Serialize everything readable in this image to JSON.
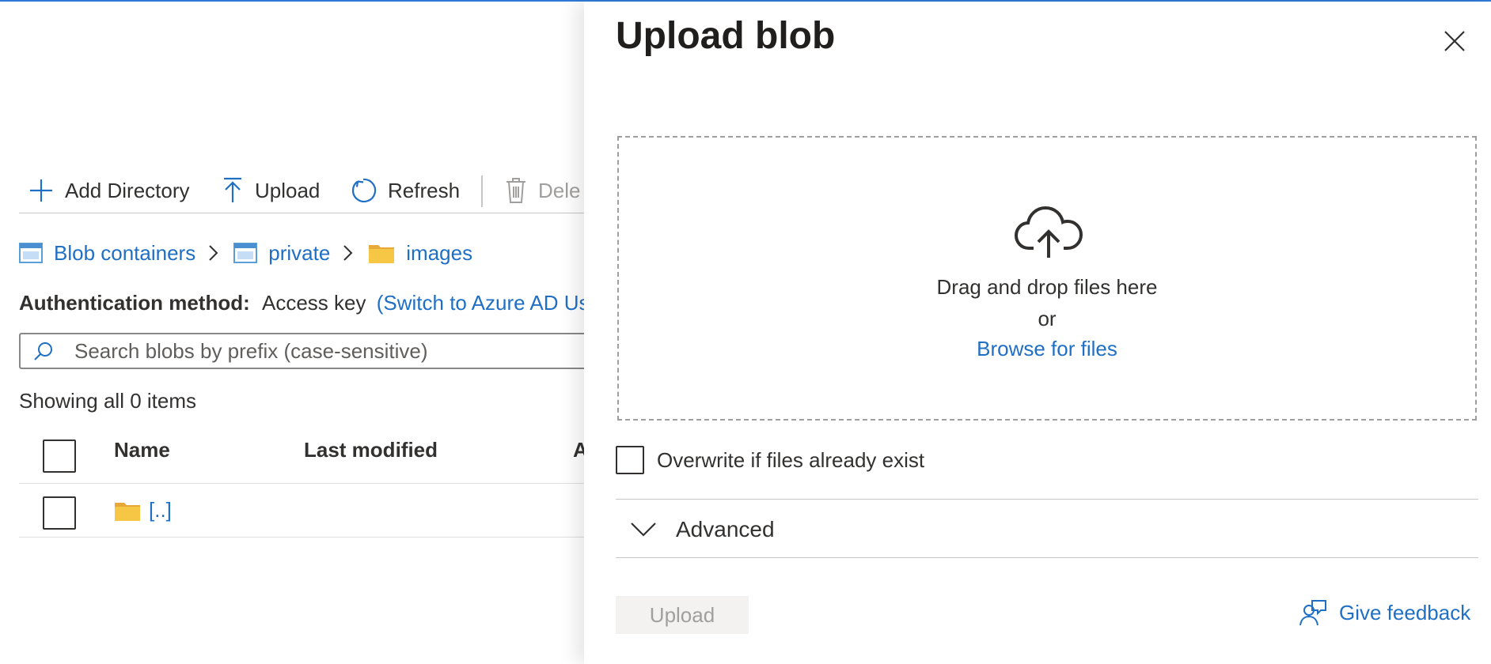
{
  "toolbar": {
    "add_directory_label": "Add Directory",
    "upload_label": "Upload",
    "refresh_label": "Refresh",
    "delete_label": "Dele"
  },
  "breadcrumb": {
    "items": [
      {
        "label": "Blob containers",
        "icon": "container-icon"
      },
      {
        "label": "private",
        "icon": "container-icon"
      },
      {
        "label": "images",
        "icon": "folder-icon"
      }
    ]
  },
  "auth": {
    "label": "Authentication method:",
    "value": "Access key",
    "switch_link": "(Switch to Azure AD User"
  },
  "search": {
    "placeholder": "Search blobs by prefix (case-sensitive)"
  },
  "list": {
    "count_text": "Showing all 0 items",
    "columns": [
      "Name",
      "Last modified",
      "A"
    ],
    "rows": [
      {
        "name": "[..]",
        "icon": "folder-icon"
      }
    ]
  },
  "panel": {
    "title": "Upload blob",
    "dropzone": {
      "line1": "Drag and drop files here",
      "line2": "or",
      "browse_link": "Browse for files"
    },
    "overwrite_label": "Overwrite if files already exist",
    "advanced_label": "Advanced",
    "upload_button": "Upload",
    "feedback_link": "Give feedback"
  },
  "colors": {
    "accent": "#1f6fc5",
    "folder": "#f6c744",
    "top_line": "#2f7ad6"
  }
}
